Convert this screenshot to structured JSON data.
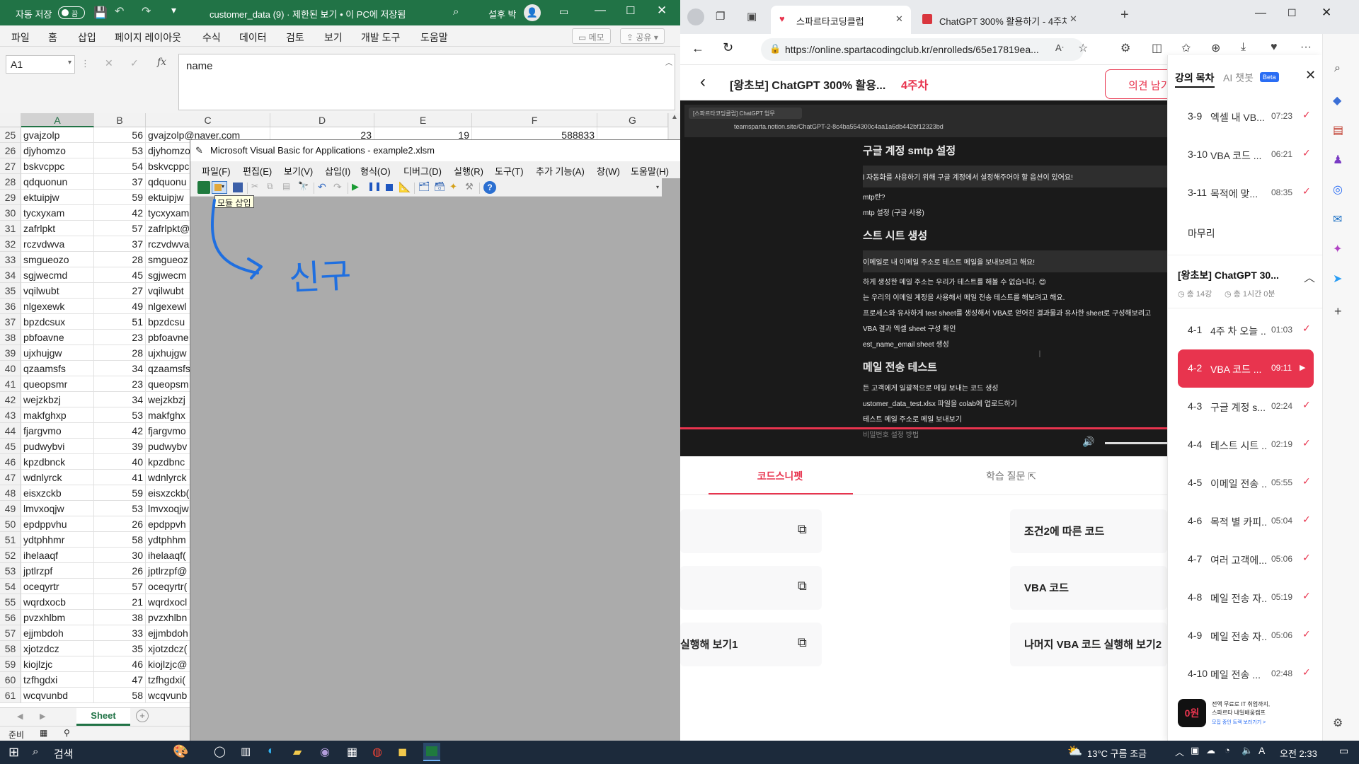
{
  "excel": {
    "autosave_label": "자동 저장",
    "autosave_state": "끔",
    "title": "customer_data (9)  ·  제한된 보기 • 이 PC에 저장됨",
    "user_name": "설후 박",
    "menu": [
      "파일",
      "홈",
      "삽입",
      "페이지 레이아웃",
      "수식",
      "데이터",
      "검토",
      "보기",
      "개발 도구",
      "도움말"
    ],
    "memo_label": "메모",
    "share_label": "공유",
    "name_box": "A1",
    "fx_label": "fx",
    "formula_value": "name",
    "columns": [
      "A",
      "B",
      "C",
      "D",
      "E",
      "F",
      "G"
    ],
    "row_first": {
      "rn": "25",
      "a": "gvajzolp",
      "b": "56",
      "c": "gvajzolp@naver.com",
      "d": "23",
      "e": "19",
      "f": "588833"
    },
    "rows": [
      {
        "rn": "26",
        "a": "djyhomzo",
        "b": "53",
        "c": "djyhomzo"
      },
      {
        "rn": "27",
        "a": "bskvcppc",
        "b": "54",
        "c": "bskvcppc"
      },
      {
        "rn": "28",
        "a": "qdquonun",
        "b": "37",
        "c": "qdquonu"
      },
      {
        "rn": "29",
        "a": "ektuipjw",
        "b": "59",
        "c": "ektuipjw"
      },
      {
        "rn": "30",
        "a": "tycxyxam",
        "b": "42",
        "c": "tycxyxam"
      },
      {
        "rn": "31",
        "a": "zafrlpkt",
        "b": "57",
        "c": "zafrlpkt@"
      },
      {
        "rn": "32",
        "a": "rczvdwva",
        "b": "37",
        "c": "rczvdwva"
      },
      {
        "rn": "33",
        "a": "smgueozo",
        "b": "28",
        "c": "smgueoz"
      },
      {
        "rn": "34",
        "a": "sgjwecmd",
        "b": "45",
        "c": "sgjwecm"
      },
      {
        "rn": "35",
        "a": "vqilwubt",
        "b": "27",
        "c": "vqilwubt"
      },
      {
        "rn": "36",
        "a": "nlgexewk",
        "b": "49",
        "c": "nlgexewl"
      },
      {
        "rn": "37",
        "a": "bpzdcsux",
        "b": "51",
        "c": "bpzdcsu"
      },
      {
        "rn": "38",
        "a": "pbfoavne",
        "b": "23",
        "c": "pbfoavne"
      },
      {
        "rn": "39",
        "a": "ujxhujgw",
        "b": "28",
        "c": "ujxhujgw"
      },
      {
        "rn": "40",
        "a": "qzaamsfs",
        "b": "34",
        "c": "qzaamsfs"
      },
      {
        "rn": "41",
        "a": "queopsmr",
        "b": "23",
        "c": "queopsm"
      },
      {
        "rn": "42",
        "a": "wejzkbzj",
        "b": "34",
        "c": "wejzkbzj"
      },
      {
        "rn": "43",
        "a": "makfghxp",
        "b": "53",
        "c": "makfghx"
      },
      {
        "rn": "44",
        "a": "fjargvmo",
        "b": "42",
        "c": "fjargvmo"
      },
      {
        "rn": "45",
        "a": "pudwybvi",
        "b": "39",
        "c": "pudwybv"
      },
      {
        "rn": "46",
        "a": "kpzdbnck",
        "b": "40",
        "c": "kpzdbnc"
      },
      {
        "rn": "47",
        "a": "wdnlyrck",
        "b": "41",
        "c": "wdnlyrck"
      },
      {
        "rn": "48",
        "a": "eisxzckb",
        "b": "59",
        "c": "eisxzckb("
      },
      {
        "rn": "49",
        "a": "lmvxoqjw",
        "b": "53",
        "c": "lmvxoqjw"
      },
      {
        "rn": "50",
        "a": "epdppvhu",
        "b": "26",
        "c": "epdppvh"
      },
      {
        "rn": "51",
        "a": "ydtphhmr",
        "b": "58",
        "c": "ydtphhm"
      },
      {
        "rn": "52",
        "a": "ihelaaqf",
        "b": "30",
        "c": "ihelaaqf("
      },
      {
        "rn": "53",
        "a": "jptlrzpf",
        "b": "26",
        "c": "jptlrzpf@"
      },
      {
        "rn": "54",
        "a": "oceqyrtr",
        "b": "57",
        "c": "oceqyrtr("
      },
      {
        "rn": "55",
        "a": "wqrdxocb",
        "b": "21",
        "c": "wqrdxocl"
      },
      {
        "rn": "56",
        "a": "pvzxhlbm",
        "b": "38",
        "c": "pvzxhlbn"
      },
      {
        "rn": "57",
        "a": "ejjmbdoh",
        "b": "33",
        "c": "ejjmbdoh"
      },
      {
        "rn": "58",
        "a": "xjotzdcz",
        "b": "35",
        "c": "xjotzdcz("
      },
      {
        "rn": "59",
        "a": "kiojlzjc",
        "b": "46",
        "c": "kiojlzjc@"
      },
      {
        "rn": "60",
        "a": "tzfhgdxi",
        "b": "47",
        "c": "tzfhgdxi("
      },
      {
        "rn": "61",
        "a": "wcqvunbd",
        "b": "58",
        "c": "wcqvunb"
      }
    ],
    "sheet_tab": "Sheet",
    "status": "준비"
  },
  "vba": {
    "title": "Microsoft Visual Basic for Applications - example2.xlsm",
    "menu": [
      "파일(F)",
      "편집(E)",
      "보기(V)",
      "삽입(I)",
      "형식(O)",
      "디버그(D)",
      "실행(R)",
      "도구(T)",
      "추가 기능(A)",
      "창(W)",
      "도움말(H)"
    ],
    "tooltip": "모듈 삽입",
    "annotation": "신구"
  },
  "browser": {
    "tabs": [
      {
        "label": "스파르타코딩클럽",
        "active": true
      },
      {
        "label": "ChatGPT 300% 활용하기 - 4주차",
        "active": false
      }
    ],
    "url": "https://online.spartacodingclub.kr/enrolleds/65e17819ea...",
    "course_title": "[왕초보] ChatGPT 300% 활용...",
    "week": "4주차",
    "feedback_btn": "의견 남기",
    "video": {
      "tab_label": "[스파르타코딩클럽] ChatGPT 업무",
      "url": "teamsparta.notion.site/ChatGPT-2-8c4ba554300c4aa1a6db442bf12323bd",
      "lines": [
        {
          "t": "구글 계정 smtp 설정",
          "k": "h"
        },
        {
          "t": "l 자동화를 사용하기 위해 구글 계정에서 설정해주어야 할 옵션이 있어요!",
          "k": "box"
        },
        {
          "t": "mtp란?",
          "k": "p"
        },
        {
          "t": "mtp 설정 (구글 사용)",
          "k": "p"
        },
        {
          "t": "스트 시트 생성",
          "k": "h"
        },
        {
          "t": "이메일로 내 이메일 주소로 테스트 메일을 보내보려고 해요!",
          "k": "box"
        },
        {
          "t": "하게 생성한 메일 주소는 우리가 테스트를 해볼 수 없습니다. 😊",
          "k": "p"
        },
        {
          "t": "는 우리의 이메일 계정을 사용해서 메일 전송 테스트를 해보려고 해요.",
          "k": "p"
        },
        {
          "t": "프로세스와 유사하게 test sheet를 생성해서 VBA로 얻어진 결과물과 유사한 sheet로 구성해보려고",
          "k": "p"
        },
        {
          "t": "VBA 결과 엑셀 sheet 구성 확인",
          "k": "p"
        },
        {
          "t": "est_name_email sheet  생성",
          "k": "p"
        },
        {
          "t": "메일 전송 테스트",
          "k": "h"
        },
        {
          "t": "든 고객에게 일괄적으로 메일 보내는 코드 생성",
          "k": "p"
        },
        {
          "t": "ustomer_data_test.xlsx 파일을 colab에 업로드하기",
          "k": "p"
        },
        {
          "t": "테스트 메일 주소로 메일 보내보기",
          "k": "p"
        },
        {
          "t": "비밀번호 설정 방법",
          "k": "dim"
        }
      ]
    },
    "content_tabs": [
      {
        "label": "코드스니펫",
        "active": true
      },
      {
        "label": "학습 질문",
        "active": false
      }
    ],
    "snippets": [
      {
        "left": "",
        "right": "조건2에 따른 코드"
      },
      {
        "left": "",
        "right": "VBA 코드"
      },
      {
        "left": "실행해 보기1",
        "right": "나머지 VBA 코드 실행해 보기2"
      }
    ],
    "sidebar": {
      "tab_toc": "강의 목차",
      "tab_ai": "AI 챗봇",
      "beta": "Beta",
      "week3": [
        {
          "num": "3-9",
          "title": "엑셀 내 VB...",
          "dur": "07:23"
        },
        {
          "num": "3-10",
          "title": "VBA 코드 ...",
          "dur": "06:21"
        },
        {
          "num": "3-11",
          "title": "목적에 맞...",
          "dur": "08:35"
        }
      ],
      "finale": "마무리",
      "section_title": "[왕초보] ChatGPT 30...",
      "section_count": "총 14강",
      "section_time": "총 1시간 0분",
      "week4": [
        {
          "num": "4-1",
          "title": "4주 차 오늘 ...",
          "dur": "01:03",
          "active": false
        },
        {
          "num": "4-2",
          "title": "VBA 코드 ...",
          "dur": "09:11",
          "active": true
        },
        {
          "num": "4-3",
          "title": "구글 계정 s...",
          "dur": "02:24",
          "active": false
        },
        {
          "num": "4-4",
          "title": "테스트 시트 ...",
          "dur": "02:19",
          "active": false
        },
        {
          "num": "4-5",
          "title": "이메일 전송 ...",
          "dur": "05:55",
          "active": false
        },
        {
          "num": "4-6",
          "title": "목적 별 카피...",
          "dur": "05:04",
          "active": false
        },
        {
          "num": "4-7",
          "title": "여러 고객에...",
          "dur": "05:06",
          "active": false
        },
        {
          "num": "4-8",
          "title": "메일 전송 자...",
          "dur": "05:19",
          "active": false
        },
        {
          "num": "4-9",
          "title": "메일 전송 자...",
          "dur": "05:06",
          "active": false
        },
        {
          "num": "4-10",
          "title": "메일 전송 ...",
          "dur": "02:48",
          "active": false
        }
      ],
      "ad_badge": "0원",
      "ad_line1": "전액 무료로 IT 취업까지,",
      "ad_line2": "스파르타 내일배움캠프",
      "ad_link": "모집 중인 트랙 보러가기 >"
    }
  },
  "taskbar": {
    "search": "검색",
    "weather": "13°C  구름 조금",
    "time": "오전 2:33",
    "ime": "A"
  },
  "colors": {
    "excel_green": "#217346",
    "brand_red": "#e8344e",
    "vba_gray": "#ababab",
    "ink_blue": "#1f6fe0"
  }
}
